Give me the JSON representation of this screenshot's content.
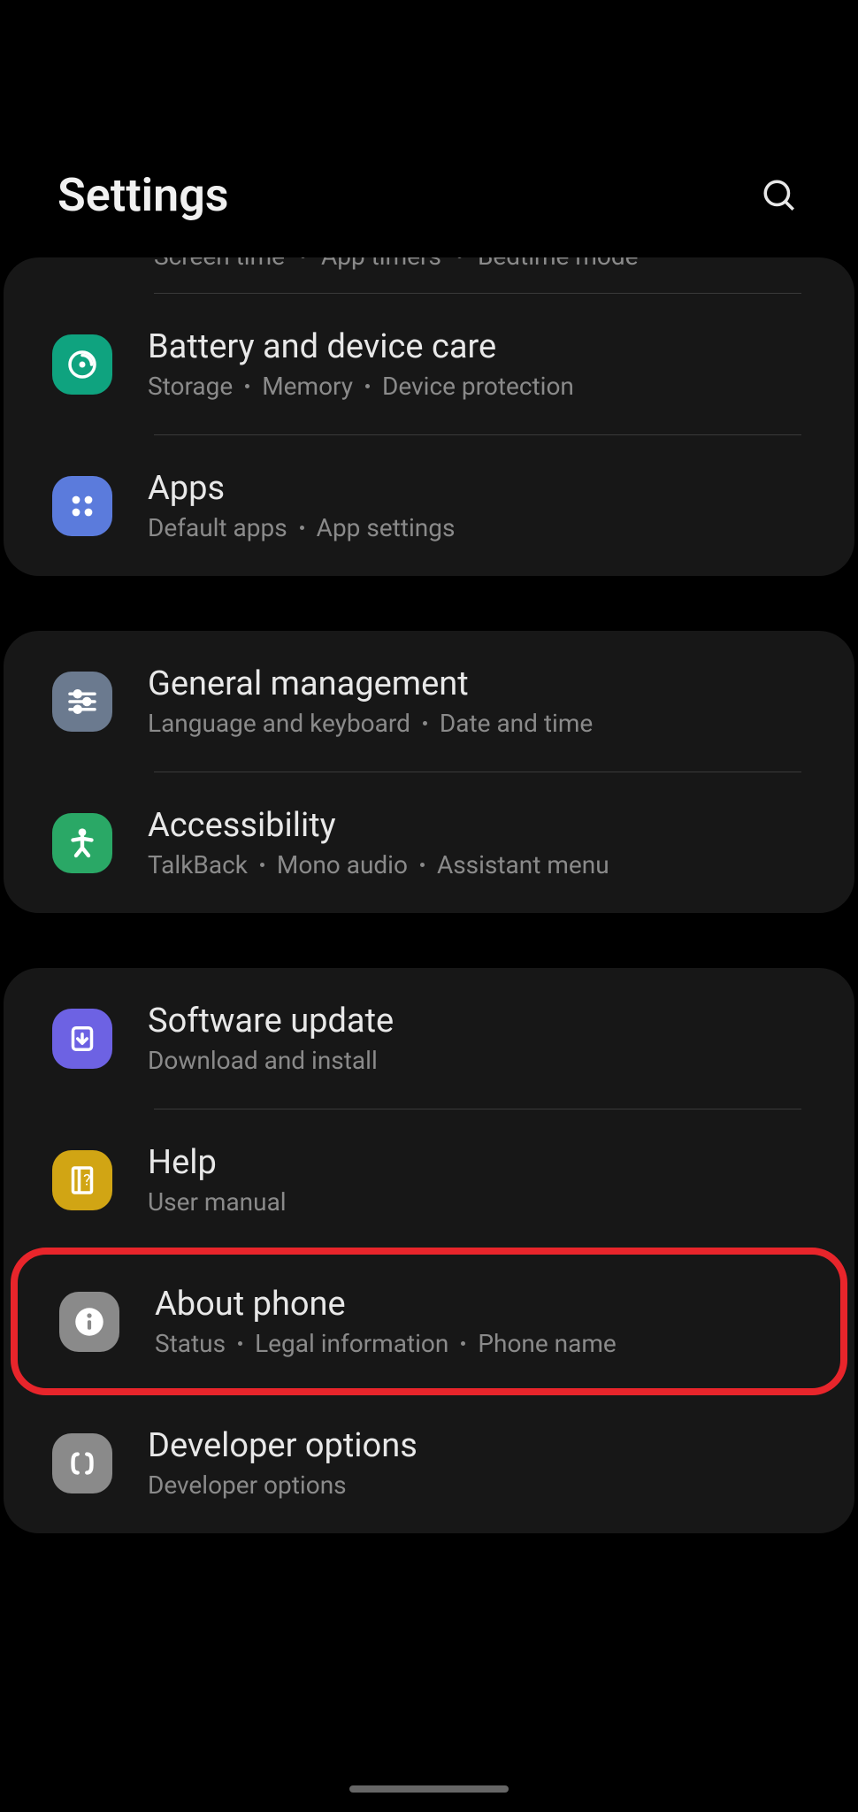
{
  "header": {
    "title": "Settings"
  },
  "cards": [
    {
      "partial": {
        "sub": [
          "Screen time",
          "App timers",
          "Bedtime mode"
        ]
      },
      "rows": [
        {
          "id": "battery",
          "title": "Battery and device care",
          "sub": [
            "Storage",
            "Memory",
            "Device protection"
          ]
        },
        {
          "id": "apps",
          "title": "Apps",
          "sub": [
            "Default apps",
            "App settings"
          ]
        }
      ]
    },
    {
      "rows": [
        {
          "id": "general",
          "title": "General management",
          "sub": [
            "Language and keyboard",
            "Date and time"
          ]
        },
        {
          "id": "accessibility",
          "title": "Accessibility",
          "sub": [
            "TalkBack",
            "Mono audio",
            "Assistant menu"
          ]
        }
      ]
    },
    {
      "rows": [
        {
          "id": "software",
          "title": "Software update",
          "sub": [
            "Download and install"
          ]
        },
        {
          "id": "help",
          "title": "Help",
          "sub": [
            "User manual"
          ]
        },
        {
          "id": "about",
          "title": "About phone",
          "sub": [
            "Status",
            "Legal information",
            "Phone name"
          ],
          "highlighted": true
        },
        {
          "id": "developer",
          "title": "Developer options",
          "sub": [
            "Developer options"
          ]
        }
      ]
    }
  ]
}
